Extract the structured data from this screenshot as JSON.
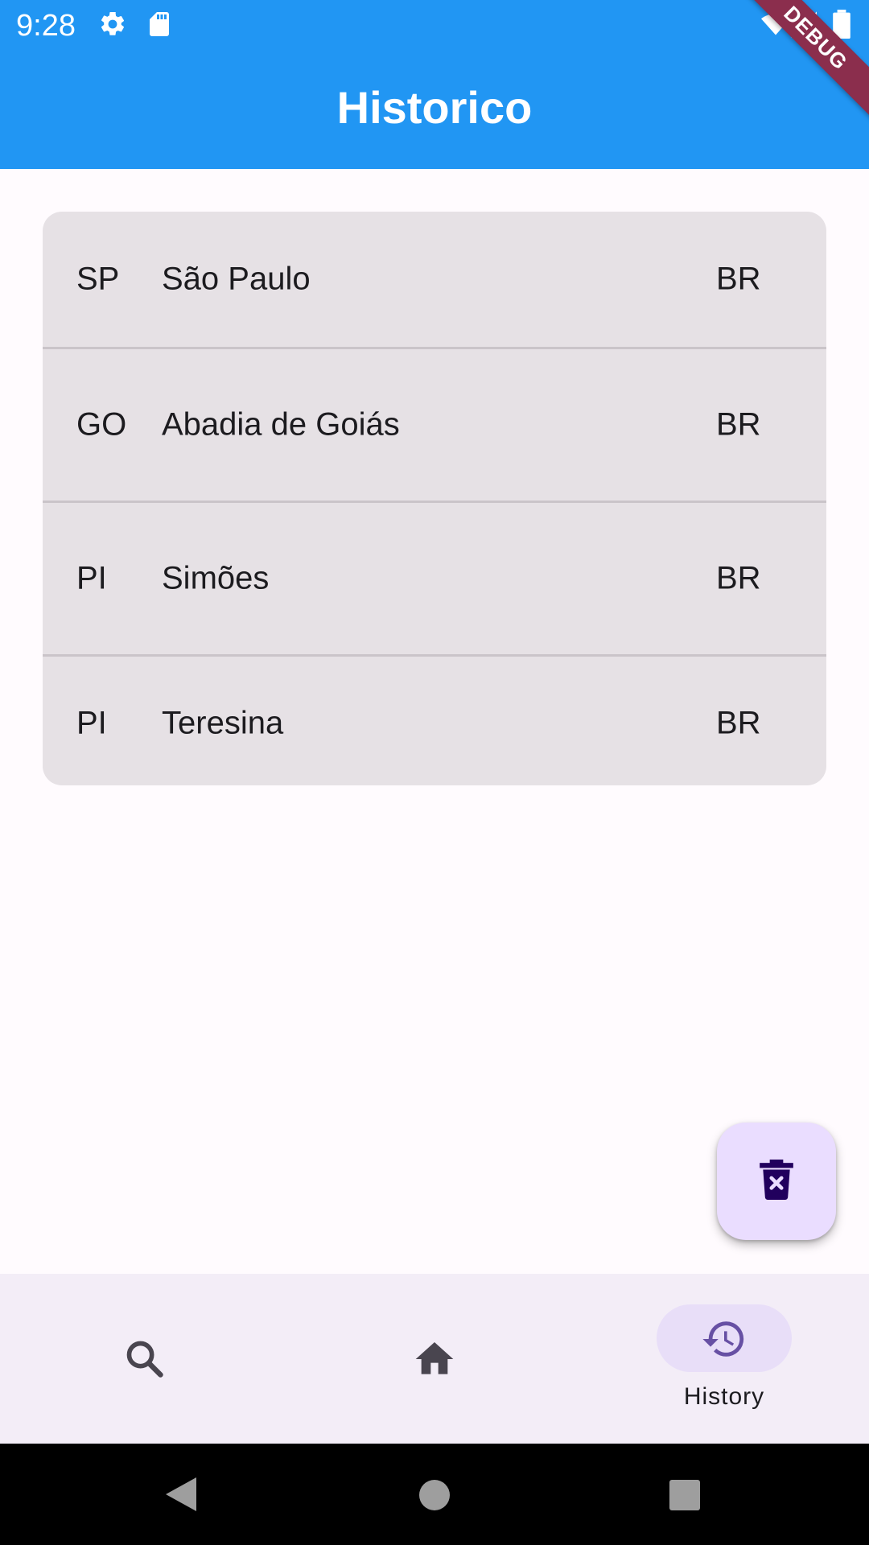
{
  "status_bar": {
    "time": "9:28",
    "left_icons": [
      "gear-icon",
      "sd-card-icon"
    ],
    "right_icons": [
      "wifi-icon",
      "cell-signal-icon",
      "battery-icon"
    ]
  },
  "app_bar": {
    "title": "Historico",
    "debug_banner": "DEBUG",
    "background": "#2196f3"
  },
  "history": {
    "rows": [
      {
        "state": "SP",
        "city": "São Paulo",
        "country": "BR"
      },
      {
        "state": "GO",
        "city": "Abadia de Goiás",
        "country": "BR"
      },
      {
        "state": "PI",
        "city": "Simões",
        "country": "BR"
      },
      {
        "state": "PI",
        "city": "Teresina",
        "country": "BR"
      }
    ]
  },
  "fab": {
    "icon": "delete-forever-icon"
  },
  "bottom_nav": {
    "items": [
      {
        "icon": "search-icon",
        "label": ""
      },
      {
        "icon": "home-icon",
        "label": ""
      },
      {
        "icon": "history-icon",
        "label": "History",
        "selected": true
      }
    ],
    "accent": "#6750a4"
  },
  "system_nav": {
    "icons": [
      "back-icon",
      "home-circle-icon",
      "recents-icon"
    ]
  }
}
